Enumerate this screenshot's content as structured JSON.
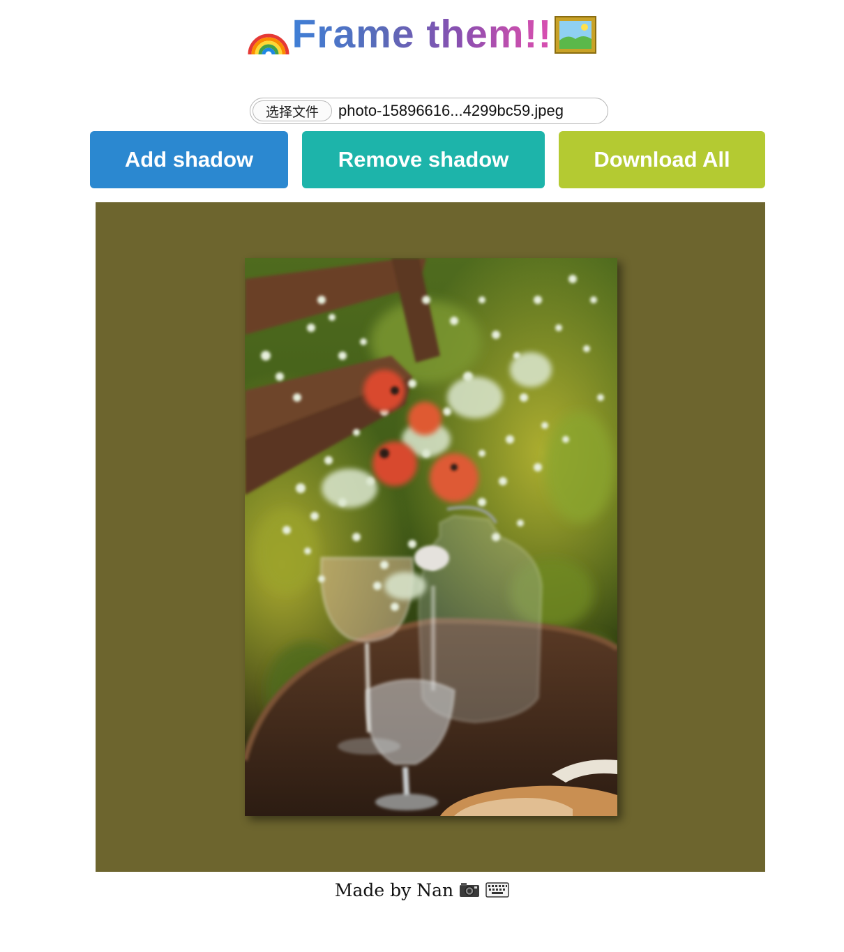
{
  "header": {
    "title": "Frame them!!",
    "left_icon": "rainbow-icon",
    "right_icon": "framed-picture-icon"
  },
  "file_input": {
    "button_label": "选择文件",
    "file_name": "photo-15896616...4299bc59.jpeg"
  },
  "toolbar": {
    "add_shadow_label": "Add shadow",
    "remove_shadow_label": "Remove shadow",
    "download_all_label": "Download All"
  },
  "frame": {
    "background_color": "#6d652e",
    "shadow_enabled": true,
    "photo_description_icon": "framed-photo"
  },
  "footer": {
    "text": "Made by Nan",
    "icons": [
      "camera-icon",
      "keyboard-icon"
    ]
  },
  "colors": {
    "add_button": "#2b88d0",
    "remove_button": "#1db4aa",
    "download_button": "#b4ca32",
    "title_gradient_start": "#3f7fd6",
    "title_gradient_end": "#d94fb0"
  }
}
